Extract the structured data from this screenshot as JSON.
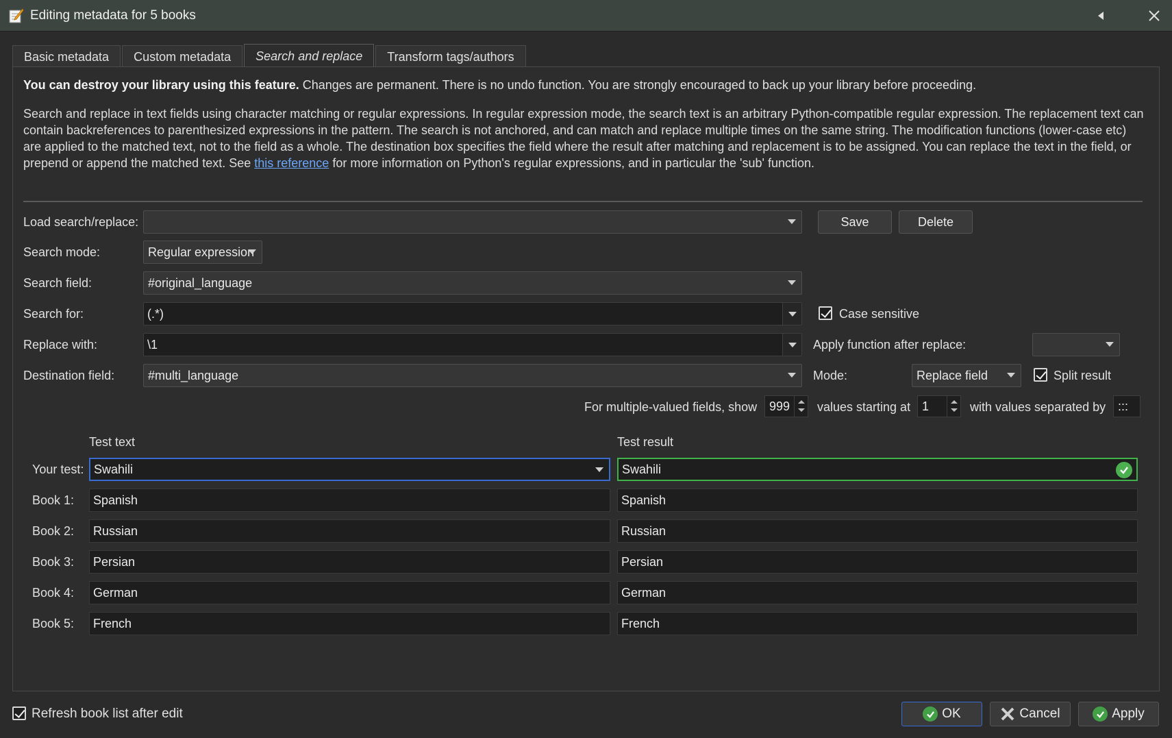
{
  "window": {
    "title": "Editing metadata for 5 books",
    "icon": "edit-metadata-icon"
  },
  "tabs": [
    {
      "label": "Basic metadata",
      "active": false
    },
    {
      "label": "Custom metadata",
      "active": false
    },
    {
      "label": "Search and replace",
      "active": true
    },
    {
      "label": "Transform tags/authors",
      "active": false
    }
  ],
  "warning": {
    "bold": "You can destroy your library using this feature.",
    "rest": " Changes are permanent. There is no undo function. You are strongly encouraged to back up your library before proceeding."
  },
  "description": {
    "part1": "Search and replace in text fields using character matching or regular expressions. In regular expression mode, the search text is an arbitrary Python-compatible regular expression. The replacement text can contain backreferences to parenthesized expressions in the pattern. The search is not anchored, and can match and replace multiple times on the same string. The modification functions (lower-case etc) are applied to the matched text, not to the field as a whole. The destination box specifies the field where the result after matching and replacement is to be assigned. You can replace the text in the field, or prepend or append the matched text. See ",
    "link": "this reference",
    "part2": " for more information on Python's regular expressions, and in particular the 'sub' function."
  },
  "form": {
    "load_label": "Load search/replace:",
    "load_value": "",
    "save_label": "Save",
    "delete_label": "Delete",
    "mode_label": "Search mode:",
    "mode_value": "Regular expression",
    "field_label": "Search field:",
    "field_value": "#original_language",
    "search_label": "Search for:",
    "search_value": "(.*)",
    "case_label": "Case sensitive",
    "case_checked": true,
    "replace_label": "Replace with:",
    "replace_value": "\\1",
    "function_label": "Apply function after replace:",
    "function_value": "",
    "dest_label": "Destination field:",
    "dest_value": "#multi_language",
    "dest_mode_label": "Mode:",
    "dest_mode_value": "Replace field",
    "split_label": "Split result",
    "split_checked": true,
    "multi_show_label": "For multiple-valued fields, show",
    "multi_show_value": "999",
    "multi_start_label": "values starting at",
    "multi_start_value": "1",
    "multi_sep_label": "with values separated by",
    "multi_sep_value": ":::"
  },
  "test": {
    "text_header": "Test text",
    "result_header": "Test result",
    "your_test_label": "Your test:",
    "your_test_value": "Swahili",
    "your_test_result": "Swahili",
    "books": [
      {
        "label": "Book 1:",
        "text": "Spanish",
        "result": "Spanish"
      },
      {
        "label": "Book 2:",
        "text": "Russian",
        "result": "Russian"
      },
      {
        "label": "Book 3:",
        "text": "Persian",
        "result": "Persian"
      },
      {
        "label": "Book 4:",
        "text": "German",
        "result": "German"
      },
      {
        "label": "Book 5:",
        "text": "French",
        "result": "French"
      }
    ]
  },
  "footer": {
    "refresh_label": "Refresh book list after edit",
    "refresh_checked": true,
    "ok_label": "OK",
    "cancel_label": "Cancel",
    "apply_label": "Apply"
  }
}
